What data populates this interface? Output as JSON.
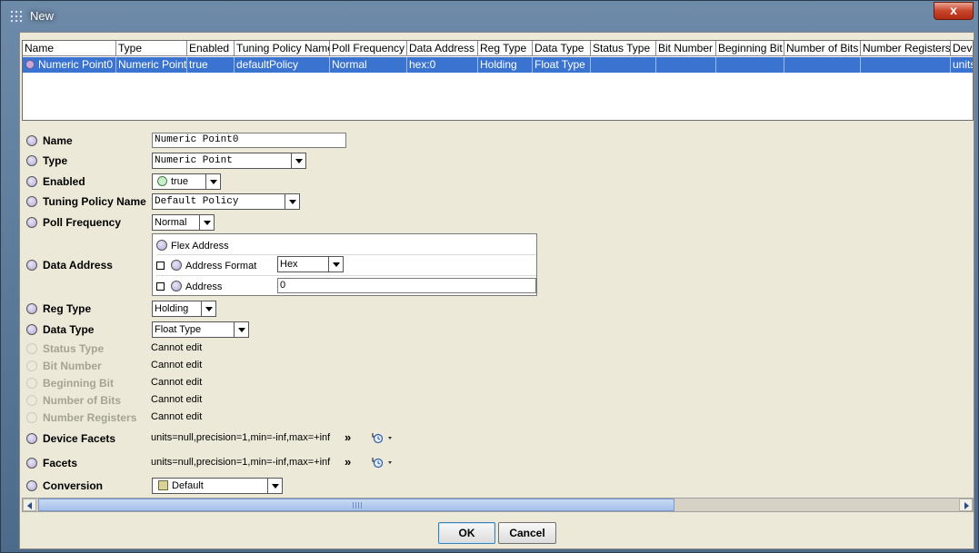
{
  "window": {
    "title": "New",
    "close_label": "x"
  },
  "table": {
    "columns": [
      "Name",
      "Type",
      "Enabled",
      "Tuning Policy Name",
      "Poll Frequency",
      "Data Address",
      "Reg Type",
      "Data Type",
      "Status Type",
      "Bit Number",
      "Beginning Bit",
      "Number of Bits",
      "Number Registers",
      "Devic"
    ],
    "row": [
      "Numeric Point0",
      "Numeric Point",
      "true",
      "defaultPolicy",
      "Normal",
      "hex:0",
      "Holding",
      "Float Type",
      "",
      "",
      "",
      "",
      "",
      "units"
    ]
  },
  "props": {
    "name": {
      "label": "Name",
      "value": "Numeric Point0"
    },
    "type": {
      "label": "Type",
      "value": "Numeric Point"
    },
    "enabled": {
      "label": "Enabled",
      "value": "true"
    },
    "tuning": {
      "label": "Tuning Policy Name",
      "value": "Default Policy"
    },
    "poll": {
      "label": "Poll Frequency",
      "value": "Normal"
    },
    "data_address": {
      "label": "Data Address",
      "flex_label": "Flex Address",
      "format_label": "Address Format",
      "format_value": "Hex",
      "address_label": "Address",
      "address_value": "0"
    },
    "reg_type": {
      "label": "Reg Type",
      "value": "Holding"
    },
    "data_type": {
      "label": "Data Type",
      "value": "Float Type"
    },
    "status_type": {
      "label": "Status Type",
      "value": "Cannot edit"
    },
    "bit_number": {
      "label": "Bit Number",
      "value": "Cannot edit"
    },
    "beginning_bit": {
      "label": "Beginning Bit",
      "value": "Cannot edit"
    },
    "number_of_bits": {
      "label": "Number of Bits",
      "value": "Cannot edit"
    },
    "number_registers": {
      "label": "Number Registers",
      "value": "Cannot edit"
    },
    "device_facets": {
      "label": "Device Facets",
      "value": "units=null,precision=1,min=-inf,max=+inf"
    },
    "facets": {
      "label": "Facets",
      "value": "units=null,precision=1,min=-inf,max=+inf"
    },
    "conversion": {
      "label": "Conversion",
      "value": "Default"
    }
  },
  "buttons": {
    "ok": "OK",
    "cancel": "Cancel"
  }
}
